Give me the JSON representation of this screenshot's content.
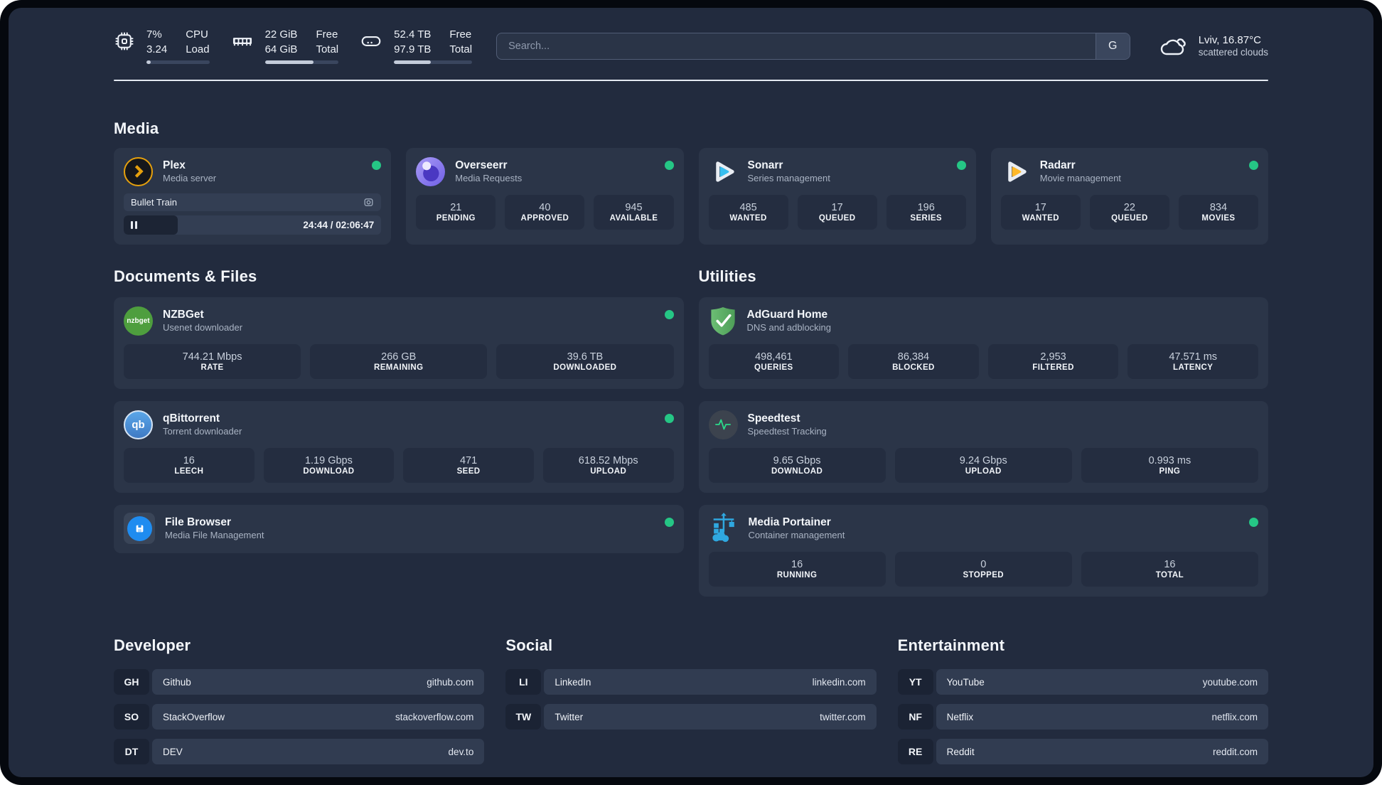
{
  "topbar": {
    "cpu": {
      "value_top": "7%",
      "value_bottom": "3.24",
      "label_top": "CPU",
      "label_bottom": "Load",
      "progress_pct": 7
    },
    "ram": {
      "value_top": "22 GiB",
      "value_bottom": "64 GiB",
      "label_top": "Free",
      "label_bottom": "Total",
      "progress_pct": 66
    },
    "disk": {
      "value_top": "52.4 TB",
      "value_bottom": "97.9 TB",
      "label_top": "Free",
      "label_bottom": "Total",
      "progress_pct": 47
    },
    "search": {
      "placeholder": "Search...",
      "provider": "G"
    },
    "weather": {
      "location": "Lviv, 16.87°C",
      "condition": "scattered clouds"
    }
  },
  "sections": {
    "media": "Media",
    "documents": "Documents & Files",
    "utilities": "Utilities",
    "developer": "Developer",
    "social": "Social",
    "entertainment": "Entertainment"
  },
  "cards": {
    "plex": {
      "name": "Plex",
      "desc": "Media server",
      "now_playing": {
        "title": "Bullet Train",
        "time": "24:44 / 02:06:47",
        "progress_pct": 21
      }
    },
    "overseerr": {
      "name": "Overseerr",
      "desc": "Media Requests",
      "stats": [
        {
          "value": "21",
          "label": "PENDING"
        },
        {
          "value": "40",
          "label": "APPROVED"
        },
        {
          "value": "945",
          "label": "AVAILABLE"
        }
      ]
    },
    "sonarr": {
      "name": "Sonarr",
      "desc": "Series management",
      "stats": [
        {
          "value": "485",
          "label": "WANTED"
        },
        {
          "value": "17",
          "label": "QUEUED"
        },
        {
          "value": "196",
          "label": "SERIES"
        }
      ]
    },
    "radarr": {
      "name": "Radarr",
      "desc": "Movie management",
      "stats": [
        {
          "value": "17",
          "label": "WANTED"
        },
        {
          "value": "22",
          "label": "QUEUED"
        },
        {
          "value": "834",
          "label": "MOVIES"
        }
      ]
    },
    "nzbget": {
      "name": "NZBGet",
      "desc": "Usenet downloader",
      "logo_text": "nzbget",
      "stats": [
        {
          "value": "744.21 Mbps",
          "label": "RATE"
        },
        {
          "value": "266 GB",
          "label": "REMAINING"
        },
        {
          "value": "39.6 TB",
          "label": "DOWNLOADED"
        }
      ]
    },
    "qbittorrent": {
      "name": "qBittorrent",
      "desc": "Torrent downloader",
      "logo_text": "qb",
      "stats": [
        {
          "value": "16",
          "label": "LEECH"
        },
        {
          "value": "1.19 Gbps",
          "label": "DOWNLOAD"
        },
        {
          "value": "471",
          "label": "SEED"
        },
        {
          "value": "618.52 Mbps",
          "label": "UPLOAD"
        }
      ]
    },
    "filebrowser": {
      "name": "File Browser",
      "desc": "Media File Management"
    },
    "adguard": {
      "name": "AdGuard Home",
      "desc": "DNS and adblocking",
      "stats": [
        {
          "value": "498,461",
          "label": "QUERIES"
        },
        {
          "value": "86,384",
          "label": "BLOCKED"
        },
        {
          "value": "2,953",
          "label": "FILTERED"
        },
        {
          "value": "47.571 ms",
          "label": "LATENCY"
        }
      ]
    },
    "speedtest": {
      "name": "Speedtest",
      "desc": "Speedtest Tracking",
      "stats": [
        {
          "value": "9.65 Gbps",
          "label": "DOWNLOAD"
        },
        {
          "value": "9.24 Gbps",
          "label": "UPLOAD"
        },
        {
          "value": "0.993 ms",
          "label": "PING"
        }
      ]
    },
    "portainer": {
      "name": "Media Portainer",
      "desc": "Container management",
      "stats": [
        {
          "value": "16",
          "label": "RUNNING"
        },
        {
          "value": "0",
          "label": "STOPPED"
        },
        {
          "value": "16",
          "label": "TOTAL"
        }
      ]
    }
  },
  "links": {
    "developer": [
      {
        "abbr": "GH",
        "name": "Github",
        "url": "github.com"
      },
      {
        "abbr": "SO",
        "name": "StackOverflow",
        "url": "stackoverflow.com"
      },
      {
        "abbr": "DT",
        "name": "DEV",
        "url": "dev.to"
      }
    ],
    "social": [
      {
        "abbr": "LI",
        "name": "LinkedIn",
        "url": "linkedin.com"
      },
      {
        "abbr": "TW",
        "name": "Twitter",
        "url": "twitter.com"
      }
    ],
    "entertainment": [
      {
        "abbr": "YT",
        "name": "YouTube",
        "url": "youtube.com"
      },
      {
        "abbr": "NF",
        "name": "Netflix",
        "url": "netflix.com"
      },
      {
        "abbr": "RE",
        "name": "Reddit",
        "url": "reddit.com"
      }
    ]
  },
  "colors": {
    "status_online": "#25C685",
    "accent_green": "#2BD98A"
  }
}
